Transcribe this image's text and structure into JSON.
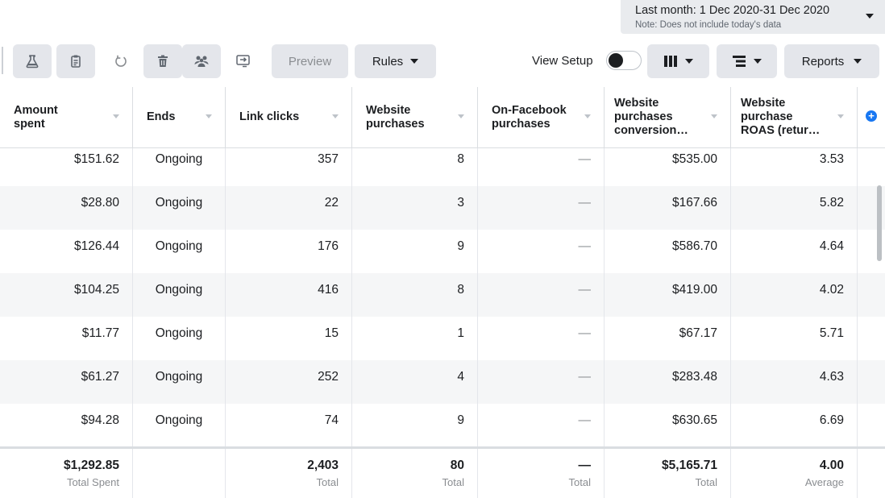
{
  "date_range": {
    "label": "Last month: 1 Dec 2020-31 Dec 2020",
    "note": "Note: Does not include today's data"
  },
  "toolbar": {
    "icons": [
      "flask-icon",
      "clipboard-icon",
      "revert-icon",
      "trash-icon",
      "audience-icon",
      "export-icon"
    ],
    "preview_label": "Preview",
    "rules_label": "Rules",
    "view_setup_label": "View Setup",
    "reports_label": "Reports"
  },
  "table": {
    "headers": [
      "Amount spent",
      "Ends",
      "Link clicks",
      "Website purchases",
      "On-Facebook purchases",
      "Website purchases conversion…",
      "Website purchase ROAS (retur…"
    ],
    "rows": [
      [
        "$151.62",
        "Ongoing",
        "357",
        "8",
        "—",
        "$535.00",
        "3.53"
      ],
      [
        "$28.80",
        "Ongoing",
        "22",
        "3",
        "—",
        "$167.66",
        "5.82"
      ],
      [
        "$126.44",
        "Ongoing",
        "176",
        "9",
        "—",
        "$586.70",
        "4.64"
      ],
      [
        "$104.25",
        "Ongoing",
        "416",
        "8",
        "—",
        "$419.00",
        "4.02"
      ],
      [
        "$11.77",
        "Ongoing",
        "15",
        "1",
        "—",
        "$67.17",
        "5.71"
      ],
      [
        "$61.27",
        "Ongoing",
        "252",
        "4",
        "—",
        "$283.48",
        "4.63"
      ],
      [
        "$94.28",
        "Ongoing",
        "74",
        "9",
        "—",
        "$630.65",
        "6.69"
      ]
    ],
    "totals": [
      {
        "value": "$1,292.85",
        "label": "Total Spent"
      },
      {
        "value": "",
        "label": ""
      },
      {
        "value": "2,403",
        "label": "Total"
      },
      {
        "value": "80",
        "label": "Total"
      },
      {
        "value": "—",
        "label": "Total"
      },
      {
        "value": "$5,165.71",
        "label": "Total"
      },
      {
        "value": "4.00",
        "label": "Average"
      }
    ]
  },
  "colors": {
    "accent": "#1877f2",
    "button_bg": "#e4e6eb",
    "alt_row": "#f5f6f7"
  }
}
